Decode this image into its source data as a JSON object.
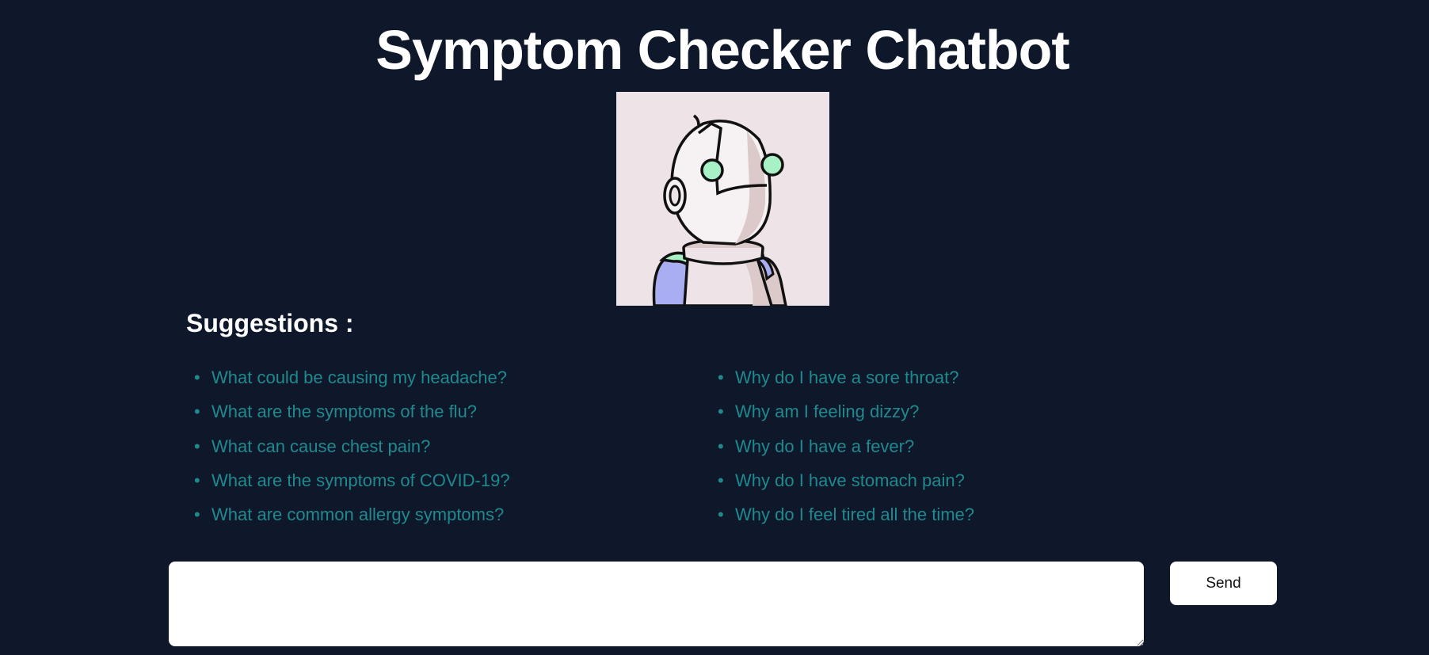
{
  "header": {
    "title": "Symptom Checker Chatbot"
  },
  "avatar": {
    "icon": "robot-illustration",
    "background_color": "#eee4e7"
  },
  "suggestions": {
    "heading": "Suggestions :",
    "left": [
      "What could be causing my headache?",
      "What are the symptoms of the flu?",
      "What can cause chest pain?",
      "What are the symptoms of COVID-19?",
      "What are common allergy symptoms?"
    ],
    "right": [
      "Why do I have a sore throat?",
      "Why am I feeling dizzy?",
      "Why do I have a fever?",
      "Why do I have stomach pain?",
      "Why do I feel tired all the time?"
    ],
    "bullet": "•",
    "link_color": "#1f8a8d"
  },
  "chat": {
    "input_value": "",
    "placeholder": "",
    "send_label": "Send"
  },
  "theme": {
    "background": "#0f172a",
    "text": "#ffffff"
  }
}
